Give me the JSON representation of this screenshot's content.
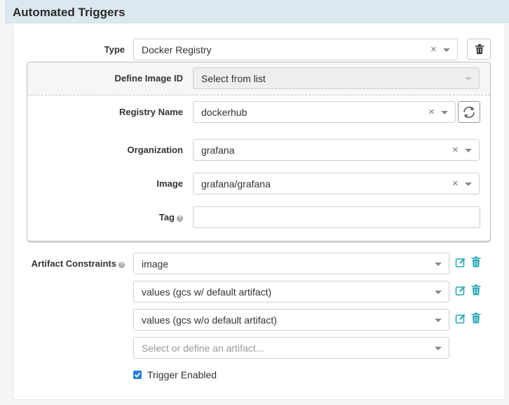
{
  "header": {
    "title": "Automated Triggers"
  },
  "type_field": {
    "label": "Type",
    "value": "Docker Registry"
  },
  "define_image": {
    "label": "Define Image ID",
    "value": "Select from list"
  },
  "registry": {
    "label": "Registry Name",
    "value": "dockerhub"
  },
  "organization": {
    "label": "Organization",
    "value": "grafana"
  },
  "image": {
    "label": "Image",
    "value": "grafana/grafana"
  },
  "tag": {
    "label": "Tag",
    "value": ""
  },
  "constraints": {
    "label": "Artifact Constraints",
    "items": [
      {
        "value": "image"
      },
      {
        "value": "values (gcs w/ default artifact)"
      },
      {
        "value": "values (gcs w/o default artifact)"
      }
    ],
    "placeholder": "Select or define an artifact..."
  },
  "trigger_enabled": {
    "label": "Trigger Enabled",
    "checked": true
  },
  "colors": {
    "accent": "#2aa8b8",
    "checkbox": "#2b7fd8",
    "header_bg": "#dbe8ef"
  }
}
